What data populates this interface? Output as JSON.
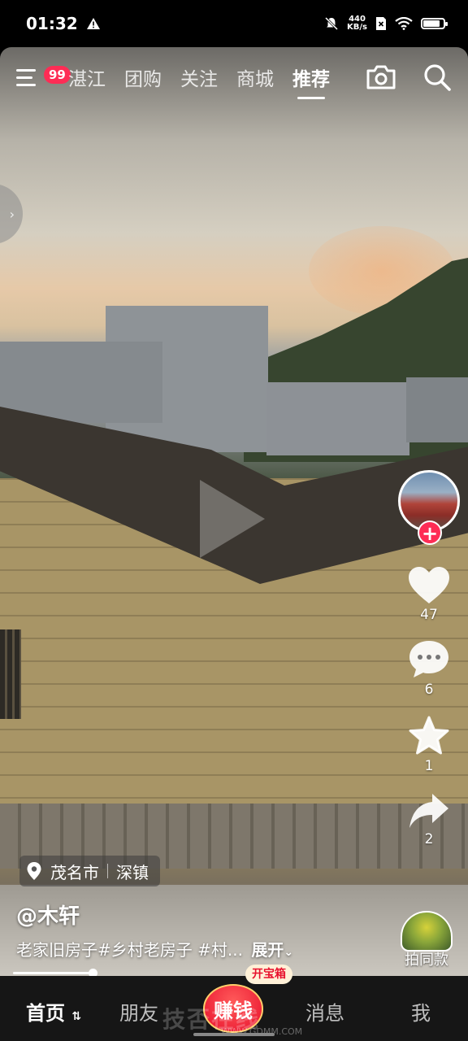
{
  "status_bar": {
    "time": "01:32",
    "net_speed_value": "440",
    "net_speed_unit": "KB/s",
    "battery_level": 0.85
  },
  "top_nav": {
    "badge_count": "99",
    "tabs": [
      {
        "label": "湛江"
      },
      {
        "label": "团购"
      },
      {
        "label": "关注"
      },
      {
        "label": "商城"
      },
      {
        "label": "推荐"
      }
    ],
    "active_tab": "推荐"
  },
  "actions": {
    "likes": "47",
    "comments": "6",
    "favorites": "1",
    "shares": "2"
  },
  "video": {
    "location_city": "茂名市",
    "location_town": "深镇",
    "author": "@木轩",
    "caption": "老家旧房子#乡村老房子 #村...",
    "expand_label": "展开",
    "same_style_label": "拍同款",
    "progress": 0.18
  },
  "bottom_nav": {
    "home": "首页",
    "friends": "朋友",
    "earn": "赚钱",
    "chest": "开宝箱",
    "messages": "消息",
    "me": "我"
  },
  "watermark": {
    "text": "技否在线",
    "url": "WWW.GDMM.COM"
  }
}
